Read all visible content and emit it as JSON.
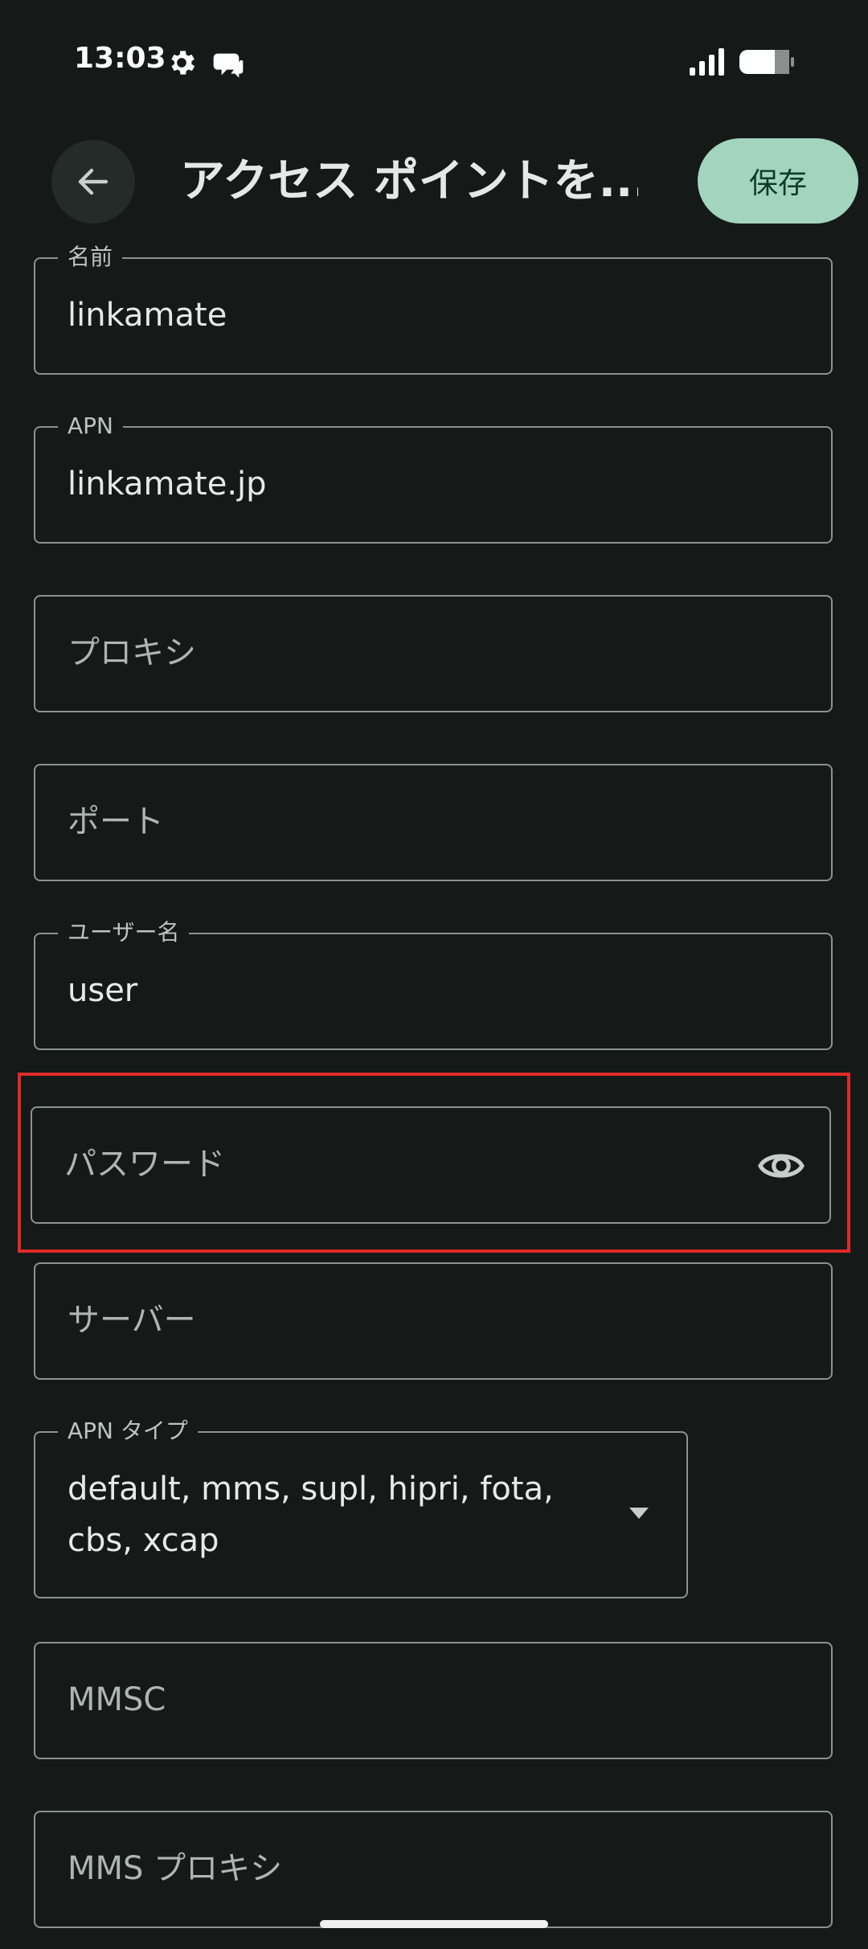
{
  "status_bar": {
    "time": "13:03",
    "icons": [
      "gear-icon",
      "chat-bubble-icon",
      "signal-icon",
      "battery-icon"
    ]
  },
  "app_bar": {
    "back_icon": "arrow-left-icon",
    "title": "アクセス ポイントを...",
    "save_label": "保存"
  },
  "fields": {
    "name": {
      "label": "名前",
      "value": "linkamate"
    },
    "apn": {
      "label": "APN",
      "value": "linkamate.jp"
    },
    "proxy": {
      "placeholder": "プロキシ"
    },
    "port": {
      "placeholder": "ポート"
    },
    "username": {
      "label": "ユーザー名",
      "value": "user"
    },
    "password": {
      "placeholder": "パスワード",
      "icon": "eye-icon"
    },
    "server": {
      "placeholder": "サーバー"
    },
    "apn_type": {
      "label": "APN タイプ",
      "value": "default, mms, supl, hipri, fota, cbs, xcap",
      "icon": "dropdown-arrow-icon"
    },
    "mmsc": {
      "placeholder": "MMSC"
    },
    "mms_proxy": {
      "placeholder": "MMS プロキシ"
    }
  },
  "colors": {
    "background": "#151a19",
    "accent": "#a3d4be",
    "highlight": "#e02a2a"
  }
}
